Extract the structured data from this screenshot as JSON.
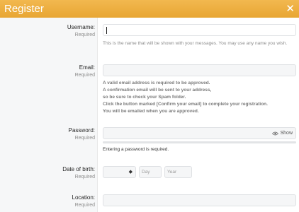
{
  "dialog": {
    "title": "Register",
    "close_icon": "close-icon"
  },
  "fields": {
    "username": {
      "label": "Username:",
      "required": "Required",
      "value": "",
      "hint": "This is the name that will be shown with your messages. You may use any name you wish."
    },
    "email": {
      "label": "Email:",
      "required": "Required",
      "value": "",
      "hints": [
        "A valid email address is required to be approved.",
        "A confirmation email will be sent to your address,",
        "so be sure to check your Spam folder.",
        "Click the button marked [Confirm your email] to complete your registration.",
        "You will be emailed when you are approved."
      ]
    },
    "password": {
      "label": "Password:",
      "required": "Required",
      "value": "",
      "show_label": "Show",
      "show_icon": "eye-icon",
      "hint": "Entering a password is required."
    },
    "dob": {
      "label": "Date of birth:",
      "required": "Required",
      "month_value": "",
      "day_placeholder": "Day",
      "year_placeholder": "Year"
    },
    "location": {
      "label": "Location:",
      "required": "Required",
      "value": ""
    }
  }
}
